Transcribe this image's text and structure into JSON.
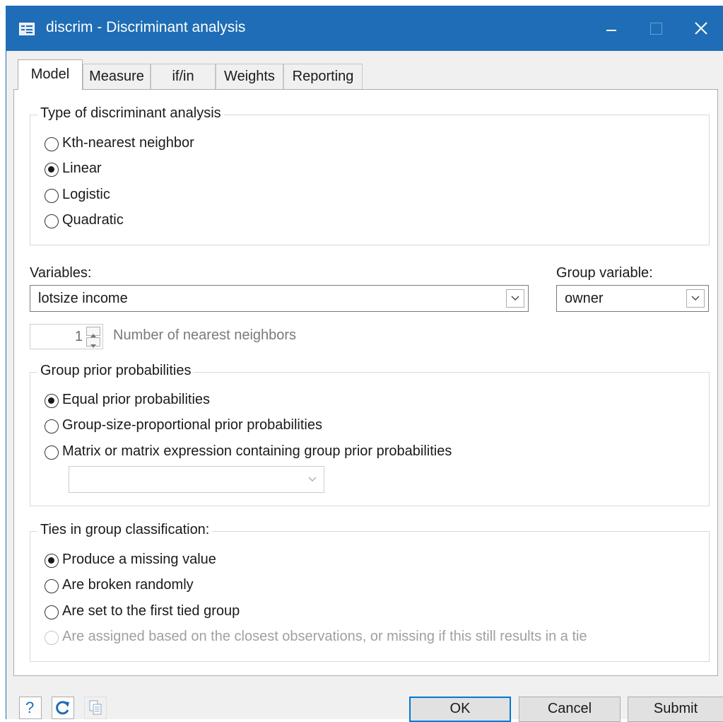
{
  "window": {
    "title": "discrim - Discriminant analysis",
    "icon": "dialog-icon"
  },
  "tabs": [
    {
      "label": "Model",
      "active": true
    },
    {
      "label": "Measure",
      "active": false
    },
    {
      "label": "if/in",
      "active": false
    },
    {
      "label": "Weights",
      "active": false
    },
    {
      "label": "Reporting",
      "active": false
    }
  ],
  "analysis_type": {
    "title": "Type of discriminant analysis",
    "options": [
      {
        "label": "Kth-nearest neighbor",
        "selected": false
      },
      {
        "label": "Linear",
        "selected": true
      },
      {
        "label": "Logistic",
        "selected": false
      },
      {
        "label": "Quadratic",
        "selected": false
      }
    ]
  },
  "variables": {
    "label": "Variables:",
    "value": "lotsize income"
  },
  "group_variable": {
    "label": "Group variable:",
    "value": "owner"
  },
  "neighbors": {
    "value": "1",
    "label": "Number of nearest neighbors",
    "enabled": false
  },
  "priors": {
    "title": "Group prior probabilities",
    "options": [
      {
        "label": "Equal prior probabilities",
        "selected": true
      },
      {
        "label": "Group-size-proportional prior probabilities",
        "selected": false
      },
      {
        "label": "Matrix or matrix expression containing group prior probabilities",
        "selected": false
      }
    ],
    "matrix_value": ""
  },
  "ties": {
    "title": "Ties in group classification:",
    "options": [
      {
        "label": "Produce a missing value",
        "selected": true,
        "enabled": true
      },
      {
        "label": "Are broken randomly",
        "selected": false,
        "enabled": true
      },
      {
        "label": "Are set to the first tied group",
        "selected": false,
        "enabled": true
      },
      {
        "label": "Are assigned based on the closest observations, or missing if this still results in a tie",
        "selected": false,
        "enabled": false
      }
    ]
  },
  "footer": {
    "help_label": "?",
    "ok_label": "OK",
    "cancel_label": "Cancel",
    "submit_label": "Submit"
  },
  "colors": {
    "titlebar": "#1e6db6",
    "default_button_border": "#0078d7"
  }
}
